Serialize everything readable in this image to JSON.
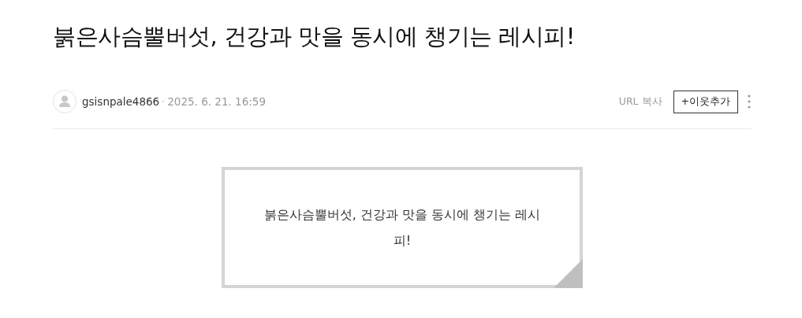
{
  "title": "붉은사슴뿔버섯, 건강과 맛을 동시에 챙기는 레시피!",
  "author": {
    "name": "gsisnpale4866",
    "date": "2025. 6. 21. 16:59"
  },
  "actions": {
    "copy_url": "URL 복사",
    "add_neighbor": "+이웃추가"
  },
  "quote_card": {
    "text": "붉은사슴뿔버섯, 건강과 맛을 동시에 챙기는 레시피!"
  }
}
